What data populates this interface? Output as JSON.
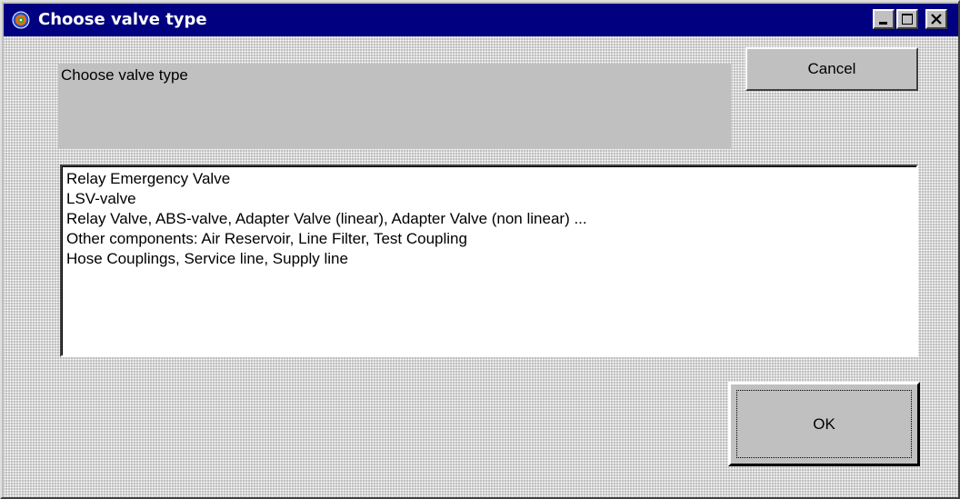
{
  "window": {
    "title": "Choose valve type",
    "title_bar_color": "#000080"
  },
  "prompt": {
    "text": "Choose valve type"
  },
  "buttons": {
    "cancel": "Cancel",
    "ok": "OK"
  },
  "valve_list": {
    "items": [
      {
        "label": "Relay Emergency Valve"
      },
      {
        "label": "LSV-valve"
      },
      {
        "label": "Relay Valve, ABS-valve, Adapter Valve (linear), Adapter Valve (non linear) ..."
      },
      {
        "label": "Other components: Air Reservoir, Line Filter, Test Coupling"
      },
      {
        "label": "Hose Couplings, Service line, Supply line"
      }
    ]
  }
}
